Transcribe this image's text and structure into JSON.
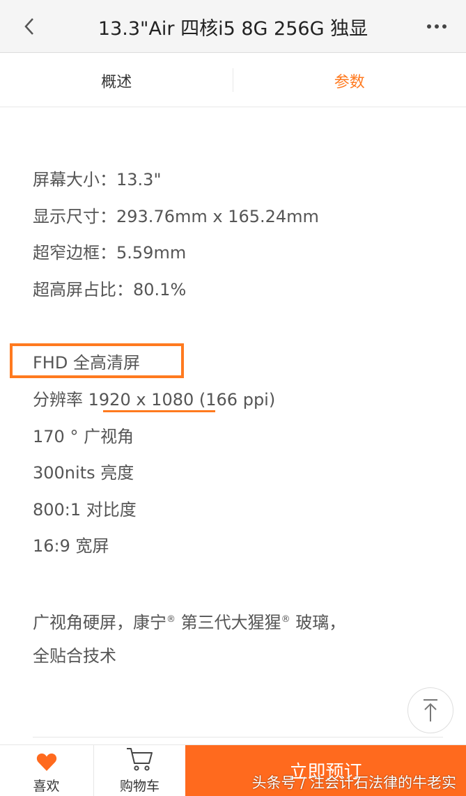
{
  "header": {
    "back_icon": "chevron-left-icon",
    "title": "13.3\"Air 四核i5 8G 256G 独显",
    "more_icon": "more-dots-icon"
  },
  "tabs": [
    {
      "label": "概述",
      "active": false
    },
    {
      "label": "参数",
      "active": true
    }
  ],
  "specs": {
    "screen_size_label": "屏幕大小：",
    "screen_size_value": "13.3\"",
    "display_dim_label": "显示尺寸：",
    "display_dim_value": "293.76mm x 165.24mm",
    "bezel_label": "超窄边框：",
    "bezel_value": "5.59mm",
    "ratio_label": "超高屏占比：",
    "ratio_value": "80.1%",
    "fhd": "FHD 全高清屏",
    "resolution_label": "分辨率",
    "resolution_value": "1920 x 1080",
    "resolution_ppi": "(166 ppi)",
    "viewing_angle": "170 ° 广视角",
    "brightness": "300nits 亮度",
    "contrast": "800:1 对比度",
    "aspect": "16:9 宽屏",
    "glass_line1_a": "广视角硬屏，康宁",
    "glass_line1_b": " 第三代大猩猩",
    "glass_line1_c": " 玻璃，",
    "registered": "®",
    "glass_line2": "全贴合技术"
  },
  "bottom": {
    "fav_label": "喜欢",
    "cart_label": "购物车",
    "buy_label": "立即预订",
    "fav_icon": "heart-icon",
    "cart_icon": "cart-icon",
    "backtop_icon": "back-to-top-icon"
  },
  "watermark": "头条号 / 注会计石法律的牛老实",
  "colors": {
    "accent": "#ff7a1f",
    "buy_bg": "#ff6a1e",
    "text": "#555555"
  }
}
